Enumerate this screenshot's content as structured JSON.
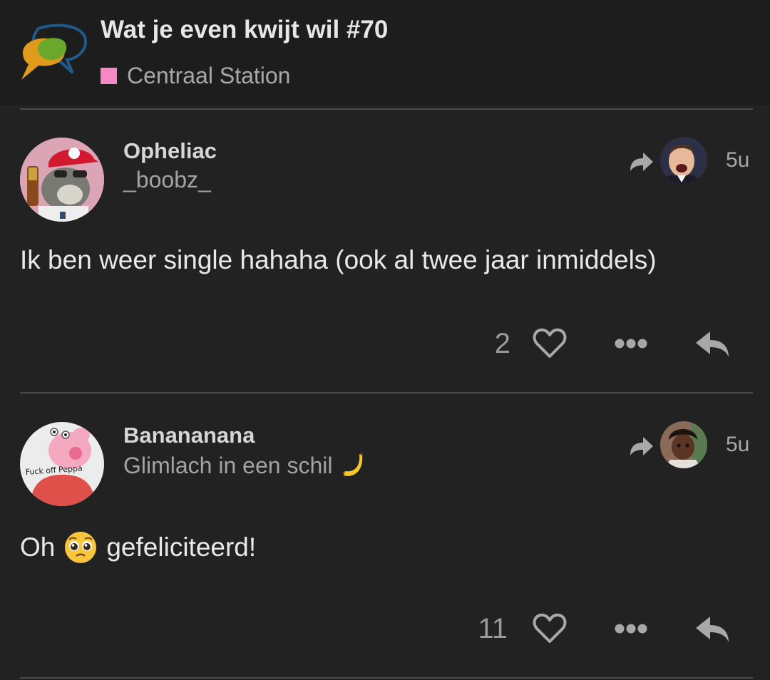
{
  "topic": {
    "title": "Wat je even kwijt wil #70",
    "category": "Centraal Station",
    "category_color": "#f588c5"
  },
  "posts": [
    {
      "author": "Opheliac",
      "user_title": "_boobz_",
      "age": "5u",
      "body": "Ik ben weer single hahaha (ook al twee jaar inmiddels)",
      "likes": "2",
      "avatar_icon": "otter-avatar",
      "reply_to_avatar_icon": "laughing-man-avatar"
    },
    {
      "author": "Banananana",
      "user_title": "Glimlach in een schil",
      "user_title_emoji": "banana-emoji",
      "age": "5u",
      "body_before": "Oh",
      "body_emoji": "pleading-face-emoji",
      "body_after": "gefeliciteerd!",
      "likes": "11",
      "avatar_icon": "peppa-avatar",
      "avatar_caption": "Fuck off Peppa",
      "reply_to_avatar_icon": "child-avatar"
    }
  ],
  "icons": {
    "reply_to": "share-arrow-icon",
    "like": "heart-icon",
    "more": "ellipsis-icon",
    "reply": "reply-arrow-icon"
  }
}
